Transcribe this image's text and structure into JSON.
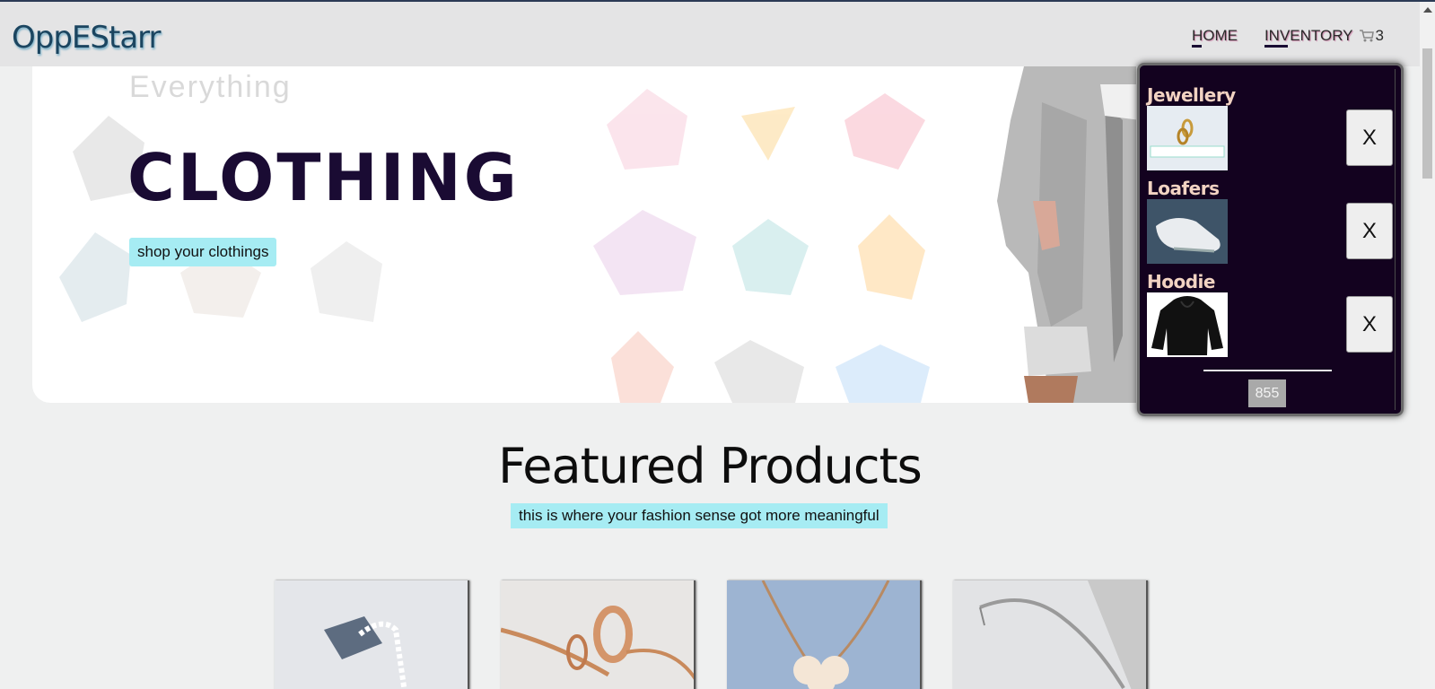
{
  "header": {
    "logo": "OppEStarr",
    "nav": {
      "home": "HOME",
      "inventory": "INVENTORY",
      "cart_count": "3"
    }
  },
  "hero": {
    "subtitle": "Everything",
    "title": "CLOTHING",
    "button": "shop your clothings"
  },
  "cart": {
    "items": [
      {
        "name": "Jewellery",
        "remove": "X"
      },
      {
        "name": "Loafers",
        "remove": "X"
      },
      {
        "name": "Hoodie",
        "remove": "X"
      }
    ],
    "total": "855"
  },
  "featured": {
    "title": "Featured Products",
    "subtitle": "this is where your fashion sense got more meaningful"
  },
  "icons": {
    "cart": "cart-icon"
  },
  "colors": {
    "accent": "#a6ecf3",
    "dark": "#13021f",
    "title": "#1a0b33"
  }
}
